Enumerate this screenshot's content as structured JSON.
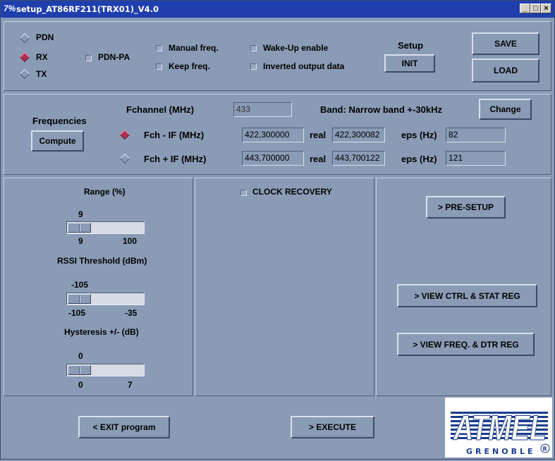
{
  "window": {
    "title": "setup_AT86RF211(TRX01)_V4.0",
    "app_icon": "7%",
    "controls": {
      "minimize": "_",
      "maximize": "□",
      "close": "×"
    }
  },
  "mode": {
    "options": [
      {
        "label": "PDN",
        "selected": false
      },
      {
        "label": "RX",
        "selected": true
      },
      {
        "label": "TX",
        "selected": false
      }
    ],
    "pdn_pa": "PDN-PA"
  },
  "options": {
    "manual_freq": "Manual freq.",
    "keep_freq": "Keep freq.",
    "wake_up": "Wake-Up enable",
    "inverted": "Inverted output data"
  },
  "setup": {
    "label": "Setup",
    "init": "INIT",
    "save": "SAVE",
    "load": "LOAD"
  },
  "frequencies": {
    "title": "Frequencies",
    "compute": "Compute",
    "fchannel_label": "Fchannel  (MHz)",
    "fchannel_value": "433",
    "band_label": "Band:  Narrow band +-30kHz",
    "change": "Change",
    "rows": [
      {
        "label": "Fch - IF  (MHz)",
        "value": "422,300000",
        "real_label": "real",
        "real": "422,300082",
        "eps_label": "eps (Hz)",
        "eps": "82",
        "selected": true
      },
      {
        "label": "Fch + IF  (MHz)",
        "value": "443,700000",
        "real_label": "real",
        "real": "443,700122",
        "eps_label": "eps (Hz)",
        "eps": "121",
        "selected": false
      }
    ]
  },
  "sliders": {
    "range": {
      "title": "Range (%)",
      "value": "9",
      "min": "9",
      "max": "100"
    },
    "rssi": {
      "title": "RSSI Threshold (dBm)",
      "value": "-105",
      "min": "-105",
      "max": "-35"
    },
    "hysteresis": {
      "title": "Hysteresis +/- (dB)",
      "value": "0",
      "min": "0",
      "max": "7"
    }
  },
  "clock_recovery": "CLOCK RECOVERY",
  "actions": {
    "pre_setup": "> PRE-SETUP",
    "view_ctrl": ">  VIEW CTRL & STAT REG",
    "view_freq": ">  VIEW FREQ. & DTR REG",
    "exit": "< EXIT program",
    "execute": ">   EXECUTE"
  },
  "logo": {
    "brand": "ATMEL",
    "location": "GRENOBLE",
    "mark": "®",
    "color": "#1a3c8c"
  }
}
